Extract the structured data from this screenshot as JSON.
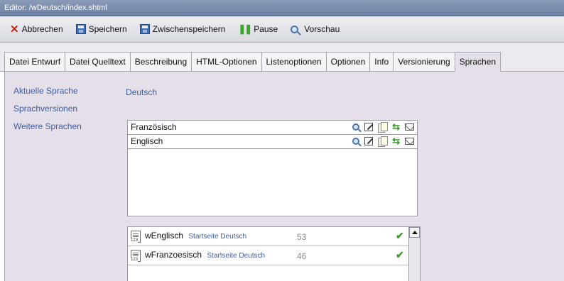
{
  "window": {
    "title": "Editor: /wDeutsch/index.shtml"
  },
  "toolbar": {
    "cancel_label": "Abbrechen",
    "save_label": "Speichern",
    "tempsave_label": "Zwischenspeichern",
    "pause_label": "Pause",
    "preview_label": "Vorschau"
  },
  "tabs": [
    {
      "label": "Datei Entwurf"
    },
    {
      "label": "Datei Quelltext"
    },
    {
      "label": "Beschreibung"
    },
    {
      "label": "HTML-Optionen"
    },
    {
      "label": "Listenoptionen"
    },
    {
      "label": "Optionen"
    },
    {
      "label": "Info"
    },
    {
      "label": "Versionierung"
    },
    {
      "label": "Sprachen"
    }
  ],
  "active_tab": "Sprachen",
  "form": {
    "current_language_label": "Aktuelle Sprache",
    "current_language_value": "Deutsch",
    "versions_label": "Sprachversionen",
    "more_languages_label": "Weitere Sprachen"
  },
  "languages": [
    {
      "name": "Französisch"
    },
    {
      "name": "Englisch"
    }
  ],
  "row_icons": [
    "search-icon",
    "edit-icon",
    "copy-icon",
    "sync-icon",
    "mail-icon"
  ],
  "pages": [
    {
      "name": "wEnglisch",
      "subtitle": "Startseite Deutsch",
      "count": "53"
    },
    {
      "name": "wFranzoesisch",
      "subtitle": "Startseite Deutsch",
      "count": "46"
    }
  ],
  "colors": {
    "accent": "#3e5ea2",
    "check": "#3a9e2a",
    "cancel": "#d81e05"
  }
}
